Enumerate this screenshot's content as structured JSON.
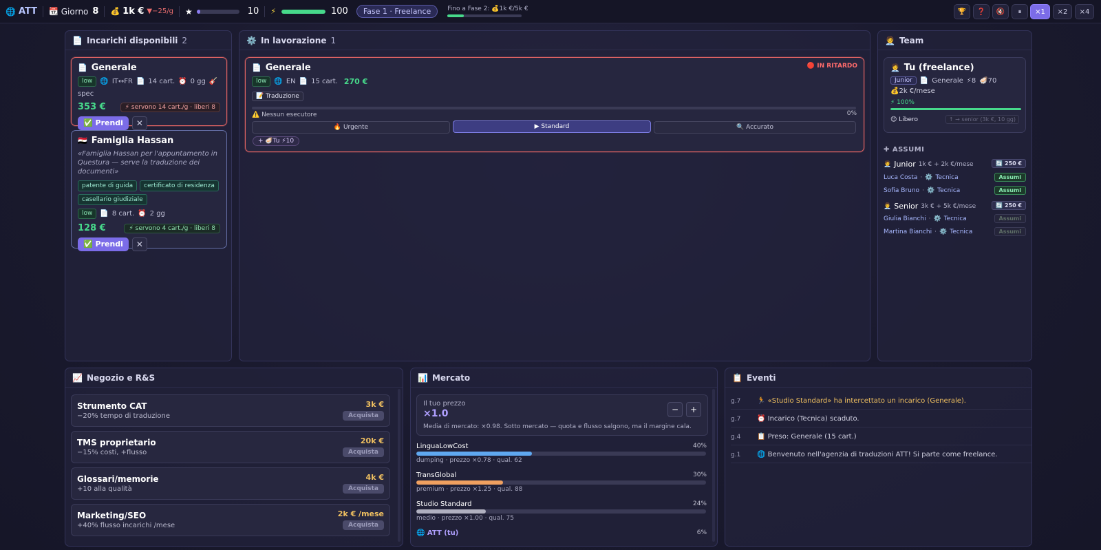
{
  "topbar": {
    "brand": "ATT",
    "brand_icon": "globe-icon",
    "day_label": "Giorno",
    "day_value": "8",
    "money": "1k €",
    "money_delta": "▼−25/g",
    "reputation_value": "10",
    "reputation_progress": 0.08,
    "energy_value": "100",
    "energy_progress": 1.0,
    "phase": "Fase 1 · Freelance",
    "next_phase": "Fino a Fase 2: 💰1k €/5k €",
    "next_phase_progress": 0.22,
    "controls": {
      "trophy": "🏆",
      "help": "❓",
      "mute": "🔇",
      "pause": "⏸",
      "speed1": "×1",
      "speed2": "×2",
      "speed4": "×4"
    }
  },
  "available": {
    "title": "Incarichi disponibili",
    "count": "2",
    "jobs": [
      {
        "title": "Generale",
        "icon": "📄",
        "level": "low",
        "langs": "IT↔FR",
        "pages": "14 cart.",
        "days": "0 gg",
        "spec": "spec",
        "price": "353 €",
        "need": "⚡ servono 14 cart./g · liberi 8",
        "take": "✅ Prendi",
        "dismiss": "✕"
      },
      {
        "title": "Famiglia Hassan",
        "icon": "🇪🇬",
        "quote": "«Famiglia Hassan per l'appuntamento in Questura — serve la traduzione dei documenti»",
        "docs": [
          "patente di guida",
          "certificato di residenza",
          "casellario giudiziale"
        ],
        "level": "low",
        "pages": "8 cart.",
        "days": "2 gg",
        "price": "128 €",
        "need": "⚡ servono 4 cart./g · liberi 8",
        "take": "✅ Prendi",
        "dismiss": "✕"
      }
    ]
  },
  "working": {
    "title": "In lavorazione",
    "count": "1",
    "job": {
      "title": "Generale",
      "status": "🔴 IN RITARDO",
      "level": "low",
      "langs": "EN",
      "pages": "15 cart.",
      "price": "270 €",
      "stage": "📝 Traduzione",
      "warning": "⚠️ Nessun esecutore",
      "progress_label": "0%",
      "progress": 0,
      "modes": [
        "🔥 Urgente",
        "▶ Standard",
        "🔍 Accurato"
      ],
      "assignee": "+ 🦪Tu ⚡10"
    }
  },
  "team": {
    "title": "Team",
    "me": {
      "title": "Tu (freelance)",
      "level": "Junior",
      "spec": "Generale",
      "speed": "⚡8",
      "quality": "🦪70",
      "salary": "💰2k €/mese",
      "energy_label": "⚡ 100%",
      "energy": 1.0,
      "status": "😊 Libero",
      "upgrade": "↑ → senior (3k €, 10 gg)"
    },
    "hire_title": "ASSUMI",
    "groups": [
      {
        "title": "Junior",
        "icon": "🧑‍💼",
        "cost_desc": "1k € + 2k €/mese",
        "badge": "🔄 250 €",
        "people": [
          {
            "name": "Luca Costa",
            "spec": "Tecnica",
            "action": "Assumi",
            "enabled": true
          },
          {
            "name": "Sofia Bruno",
            "spec": "Tecnica",
            "action": "Assumi",
            "enabled": true
          }
        ]
      },
      {
        "title": "Senior",
        "icon": "👨‍💼",
        "cost_desc": "3k € + 5k €/mese",
        "badge": "🔄 250 €",
        "people": [
          {
            "name": "Giulia Bianchi",
            "spec": "Tecnica",
            "action": "Assumi",
            "enabled": false
          },
          {
            "name": "Martina Bianchi",
            "spec": "Tecnica",
            "action": "Assumi",
            "enabled": false
          }
        ]
      }
    ]
  },
  "shop": {
    "title": "Negozio e R&S",
    "items": [
      {
        "name": "Strumento CAT",
        "desc": "−20% tempo di traduzione",
        "price": "3k €",
        "action": "Acquista"
      },
      {
        "name": "TMS proprietario",
        "desc": "−15% costi, +flusso",
        "price": "20k €",
        "action": "Acquista"
      },
      {
        "name": "Glossari/memorie",
        "desc": "+10 alla qualità",
        "price": "4k €",
        "action": "Acquista"
      },
      {
        "name": "Marketing/SEO",
        "desc": "+40% flusso incarichi /mese",
        "price": "2k € /mese",
        "action": "Acquista"
      }
    ]
  },
  "market": {
    "title": "Mercato",
    "price_label": "Il tuo prezzo",
    "price_value": "×1.0",
    "minus": "−",
    "plus": "+",
    "note": "Media di mercato: ×0.98. Sotto mercato — quota e flusso salgono, ma il margine cala.",
    "competitors": [
      {
        "name": "LinguaLowCost",
        "pct": "40%",
        "share": 0.4,
        "desc": "dumping · prezzo ×0.78 · qual. 62",
        "color": "#5fa8f0"
      },
      {
        "name": "TransGlobal",
        "pct": "30%",
        "share": 0.3,
        "desc": "premium · prezzo ×1.25 · qual. 88",
        "color": "#f0a060"
      },
      {
        "name": "Studio Standard",
        "pct": "24%",
        "share": 0.24,
        "desc": "medio · prezzo ×1.00 · qual. 75",
        "color": "#b0b0c0"
      },
      {
        "name": "🌐 ATT (tu)",
        "pct": "6%",
        "share": 0.06,
        "desc": "",
        "color": "#7b6ce8"
      }
    ]
  },
  "events": {
    "title": "Eventi",
    "rows": [
      {
        "day": "g.7",
        "text": "🏃 «Studio Standard» ha intercettato un incarico (Generale).",
        "color": "#f0c060"
      },
      {
        "day": "g.7",
        "text": "⏰ Incarico (Tecnica) scaduto.",
        "color": "#d0d0e0"
      },
      {
        "day": "g.4",
        "text": "📋 Preso: Generale (15 cart.)",
        "color": "#d0d0e0"
      },
      {
        "day": "g.1",
        "text": "🌐 Benvenuto nell'agenzia di traduzioni ATT! Si parte come freelance.",
        "color": "#d0d0e0"
      }
    ]
  }
}
